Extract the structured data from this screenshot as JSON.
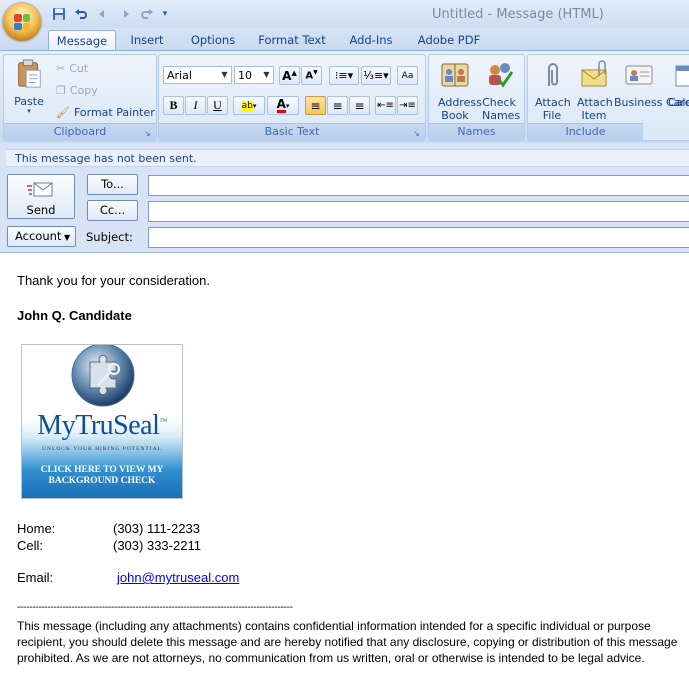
{
  "window": {
    "title": "Untitled  -  Message (HTML)"
  },
  "quick_access": [
    "save-icon",
    "undo-icon",
    "back-arrow-icon",
    "forward-arrow-icon",
    "redo-icon",
    "customize-icon"
  ],
  "tabs": [
    "Message",
    "Insert",
    "Options",
    "Format Text",
    "Add-Ins",
    "Adobe PDF"
  ],
  "active_tab": "Message",
  "ribbon": {
    "clipboard": {
      "label": "Clipboard",
      "paste": "Paste",
      "cut": "Cut",
      "copy": "Copy",
      "format_painter": "Format Painter"
    },
    "basic_text": {
      "label": "Basic Text",
      "font": "Arial",
      "size": "10"
    },
    "names": {
      "label": "Names",
      "address_book": "Address Book",
      "check_names": "Check Names"
    },
    "include": {
      "label": "Include",
      "attach_file": "Attach File",
      "attach_item": "Attach Item",
      "business_card": "Business Card",
      "calendar": "Cale"
    }
  },
  "info_bar": "This message has not been sent.",
  "compose": {
    "send": "Send",
    "to": "To...",
    "cc": "Cc...",
    "account": "Account",
    "subject": "Subject:",
    "to_value": "",
    "cc_value": "",
    "subject_value": ""
  },
  "body": {
    "thanks": "Thank you for your consideration.",
    "name": "John Q. Candidate",
    "seal": {
      "brand": "MyTruSeal",
      "tm": "™",
      "tagline": "UNLOCK YOUR HIRING POTENTIAL",
      "cta": "CLICK HERE TO VIEW MY BACKGROUND CHECK"
    },
    "home_label": "Home:",
    "home_value": "(303) 111-2233",
    "cell_label": "Cell:",
    "cell_value": "(303) 333-2211",
    "email_label": "Email:",
    "email_value": "john@mytruseal.com",
    "separator": "-------------------------------------------------------------------------------------------",
    "disclaimer_1": "This message (including any attachments) contains confidential information intended for a specific individual or purpose",
    "disclaimer_2": "recipient, you should delete this message and are hereby notified that any disclosure, copying or distribution of this message",
    "disclaimer_3": "prohibited. As we are not attorneys, no communication from us written, oral or otherwise is intended to be legal advice."
  },
  "colors": {
    "accent": "#15428b",
    "link": "#0000ee",
    "ribbon": "#d6e4f5"
  }
}
